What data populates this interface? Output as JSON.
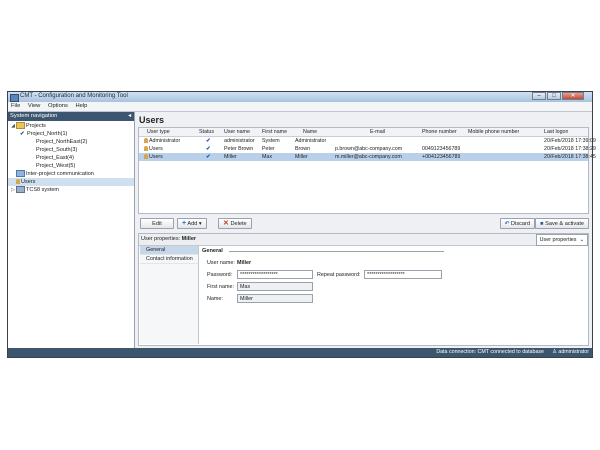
{
  "window": {
    "title": "CMT - Configuration and Monitoring Tool",
    "controls": {
      "minimize": "–",
      "maximize": "□",
      "close": "✕"
    }
  },
  "menu": [
    "File",
    "View",
    "Options",
    "Help"
  ],
  "nav": {
    "header": "System navigation",
    "collapse_glyph": "◂",
    "tree": [
      {
        "label": "Projects",
        "level": 1,
        "icon": "folder-icon",
        "expander": "◢"
      },
      {
        "label": "Project_North(1)",
        "level": 2,
        "icon": "check-icon"
      },
      {
        "label": "Project_NorthEast(2)",
        "level": 3
      },
      {
        "label": "Project_South(3)",
        "level": 3
      },
      {
        "label": "Project_East(4)",
        "level": 3
      },
      {
        "label": "Project_West(5)",
        "level": 3
      },
      {
        "label": "Inter-project communication",
        "level": 1,
        "icon": "network-icon"
      },
      {
        "label": "Users",
        "level": 1,
        "icon": "users-icon",
        "selected": true
      },
      {
        "label": "TCS8 system",
        "level": 1,
        "icon": "system-icon",
        "expander": "▷"
      }
    ]
  },
  "main": {
    "title": "Users",
    "columns": [
      "User type",
      "Status",
      "User name",
      "First name",
      "Name",
      "E-mail",
      "Phone number",
      "Mobile phone number",
      "Last logon"
    ],
    "rows": [
      [
        "Administrator",
        "✔",
        "administrator",
        "System",
        "Administrator",
        "",
        "",
        "",
        "20/Feb/2018 17:39:09"
      ],
      [
        "Users",
        "✔",
        "Peter Brown",
        "Peter",
        "Brown",
        "p.brown@abc-company.com",
        "0049123456789",
        "",
        "20/Feb/2018 17:38:29"
      ],
      [
        "Users",
        "✔",
        "Miller",
        "Max",
        "Miller",
        "m.miller@abc-company.com",
        "+004123456789",
        "",
        "20/Feb/2018 17:38:45"
      ]
    ],
    "toolbar": {
      "edit": "Edit",
      "add": "Add",
      "add_arrow": "▾",
      "delete": "Delete",
      "discard": "Discard",
      "save": "Save & activate"
    }
  },
  "properties": {
    "header_label": "User properties:",
    "header_user": "Miller",
    "dropdown": "User properties",
    "dropdown_arrow": "⌄",
    "tabs": [
      "General",
      "Contact information"
    ],
    "section": "General",
    "fields": {
      "username_label": "User name:",
      "username_value": "Miller",
      "password_label": "Password:",
      "password_value": "******************",
      "repeat_label": "Repeat password:",
      "repeat_value": "******************",
      "firstname_label": "First name:",
      "firstname_value": "Max",
      "name_label": "Name:",
      "name_value": "Miller"
    }
  },
  "status": {
    "connection": "Data connection: CMT connected to database",
    "user": "administrator"
  }
}
